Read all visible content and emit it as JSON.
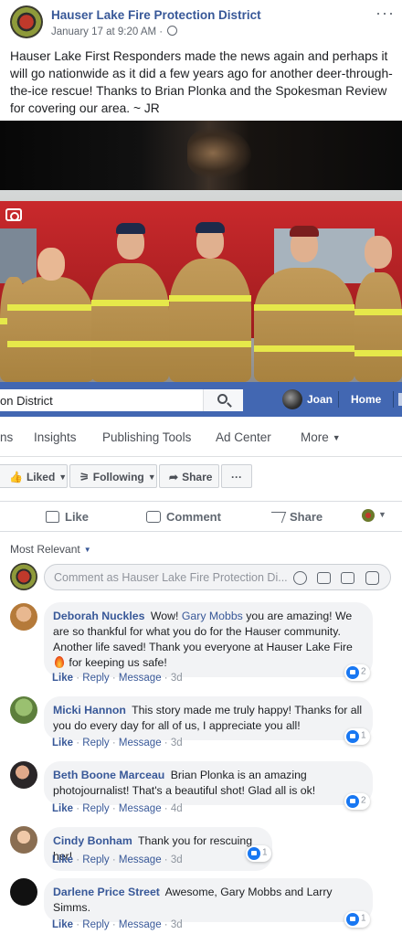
{
  "post": {
    "page_name": "Hauser Lake Fire Protection District",
    "timestamp": "January 17 at 9:20 AM",
    "meta_separator": "·",
    "more_icon": "···",
    "text": "Hauser Lake First Responders made the news again and perhaps it will go nationwide as it did a few years ago for another deer-through-the-ice rescue! Thanks to Brian Plonka and the Spokesman Review for covering our area. ~ JR"
  },
  "topbar": {
    "search_value": "on District",
    "user_name": "Joan",
    "home_label": "Home",
    "colors": {
      "bar": "#4267b2"
    }
  },
  "page_tabs": [
    "ns",
    "Insights",
    "Publishing Tools",
    "Ad Center",
    "More"
  ],
  "page_actions": {
    "liked": "Liked",
    "following": "Following",
    "share": "Share",
    "more": "···"
  },
  "post_actions": {
    "like": "Like",
    "comment": "Comment",
    "share": "Share"
  },
  "sort_label": "Most Relevant",
  "comment_input": {
    "placeholder": "Comment as Hauser Lake Fire Protection Di..."
  },
  "comment_actions": {
    "like": "Like",
    "reply": "Reply",
    "message": "Message",
    "dot": "·"
  },
  "comments": [
    {
      "author": "Deborah Nuckles",
      "text_a": "Wow!",
      "mention": "Gary Mobbs",
      "text_b": "you are amazing! We are so thankful for what you do for the Hauser community. Another life saved! Thank you everyone at Hauser Lake Fire",
      "text_c": "for keeping us safe!",
      "time": "3d",
      "reactions": "2"
    },
    {
      "author": "Micki Hannon",
      "text": "This story made me truly happy! Thanks for all you do every day for all of us, I appreciate you all!",
      "time": "3d",
      "reactions": "1"
    },
    {
      "author": "Beth Boone Marceau",
      "text": "Brian Plonka is an amazing photojournalist! That's a beautiful shot! Glad all is ok!",
      "time": "4d",
      "reactions": "2"
    },
    {
      "author": "Cindy Bonham",
      "text": "Thank you for rescuing her!",
      "time": "3d",
      "reactions": "1"
    },
    {
      "author": "Darlene Price Street",
      "text": "Awesome, Gary Mobbs and Larry Simms.",
      "time": "3d",
      "reactions": "1"
    }
  ]
}
